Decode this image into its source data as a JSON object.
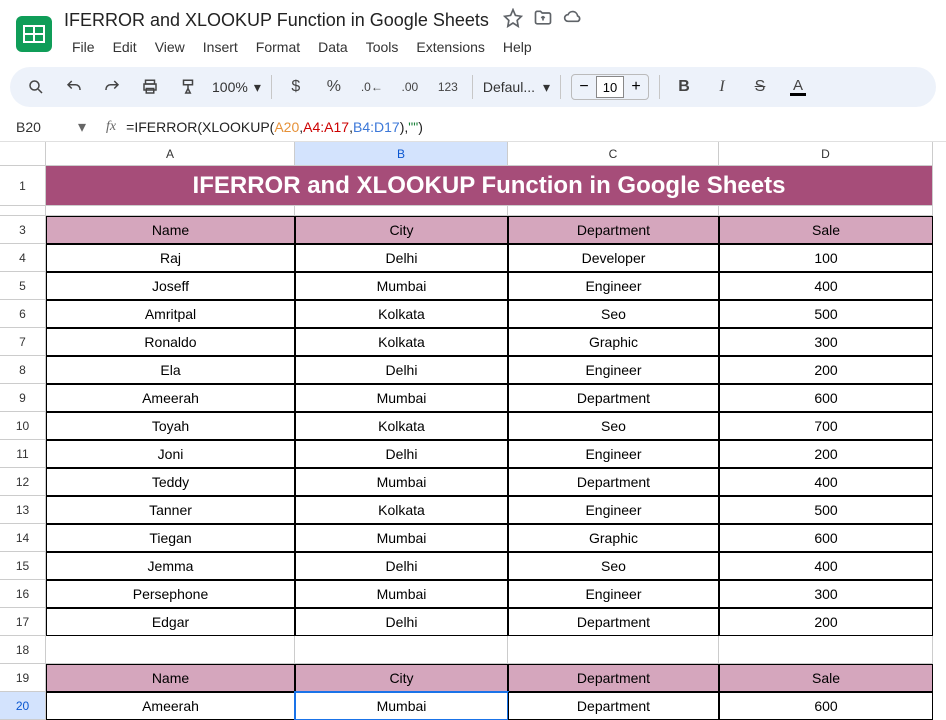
{
  "doc_title": "IFERROR and XLOOKUP  Function in Google Sheets",
  "menu": [
    "File",
    "Edit",
    "View",
    "Insert",
    "Format",
    "Data",
    "Tools",
    "Extensions",
    "Help"
  ],
  "zoom": "100%",
  "font_name": "Defaul...",
  "font_size": "10",
  "namebox": "B20",
  "formula_parts": {
    "p1": "=IFERROR(XLOOKUP(",
    "ref1": "A20",
    "c1": ",",
    "ref2": "A4:A17",
    "c2": ",",
    "ref3": "B4:D17",
    "p2": "),",
    "str": "\"\"",
    "p3": ")"
  },
  "columns": [
    "A",
    "B",
    "C",
    "D"
  ],
  "active_col": "B",
  "row_nums": [
    "1",
    "3",
    "4",
    "5",
    "6",
    "7",
    "8",
    "9",
    "10",
    "11",
    "12",
    "13",
    "14",
    "15",
    "16",
    "17",
    "18",
    "19",
    "20"
  ],
  "active_row": "20",
  "title_row": "IFERROR and XLOOKUP  Function in Google Sheets",
  "headers": [
    "Name",
    "City",
    "Department",
    "Sale"
  ],
  "data_rows": [
    [
      "Raj",
      "Delhi",
      "Developer",
      "100"
    ],
    [
      "Joseff",
      "Mumbai",
      "Engineer",
      "400"
    ],
    [
      "Amritpal",
      "Kolkata",
      "Seo",
      "500"
    ],
    [
      "Ronaldo",
      "Kolkata",
      "Graphic",
      "300"
    ],
    [
      "Ela",
      "Delhi",
      "Engineer",
      "200"
    ],
    [
      "Ameerah",
      "Mumbai",
      "Department",
      "600"
    ],
    [
      "Toyah",
      "Kolkata",
      "Seo",
      "700"
    ],
    [
      "Joni",
      "Delhi",
      "Engineer",
      "200"
    ],
    [
      "Teddy",
      "Mumbai",
      "Department",
      "400"
    ],
    [
      "Tanner",
      "Kolkata",
      "Engineer",
      "500"
    ],
    [
      "Tiegan",
      "Mumbai",
      "Graphic",
      "600"
    ],
    [
      "Jemma",
      "Delhi",
      "Seo",
      "400"
    ],
    [
      "Persephone",
      "Mumbai",
      "Engineer",
      "300"
    ],
    [
      "Edgar",
      "Delhi",
      "Department",
      "200"
    ]
  ],
  "result_row": [
    "Ameerah",
    "Mumbai",
    "Department",
    "600"
  ],
  "chart_data": {
    "type": "table",
    "headers": [
      "Name",
      "City",
      "Department",
      "Sale"
    ],
    "rows": [
      [
        "Raj",
        "Delhi",
        "Developer",
        100
      ],
      [
        "Joseff",
        "Mumbai",
        "Engineer",
        400
      ],
      [
        "Amritpal",
        "Kolkata",
        "Seo",
        500
      ],
      [
        "Ronaldo",
        "Kolkata",
        "Graphic",
        300
      ],
      [
        "Ela",
        "Delhi",
        "Engineer",
        200
      ],
      [
        "Ameerah",
        "Mumbai",
        "Department",
        600
      ],
      [
        "Toyah",
        "Kolkata",
        "Seo",
        700
      ],
      [
        "Joni",
        "Delhi",
        "Engineer",
        200
      ],
      [
        "Teddy",
        "Mumbai",
        "Department",
        400
      ],
      [
        "Tanner",
        "Kolkata",
        "Engineer",
        500
      ],
      [
        "Tiegan",
        "Mumbai",
        "Graphic",
        600
      ],
      [
        "Jemma",
        "Delhi",
        "Seo",
        400
      ],
      [
        "Persephone",
        "Mumbai",
        "Engineer",
        300
      ],
      [
        "Edgar",
        "Delhi",
        "Department",
        200
      ]
    ],
    "lookup_result": {
      "Name": "Ameerah",
      "City": "Mumbai",
      "Department": "Department",
      "Sale": 600
    }
  }
}
